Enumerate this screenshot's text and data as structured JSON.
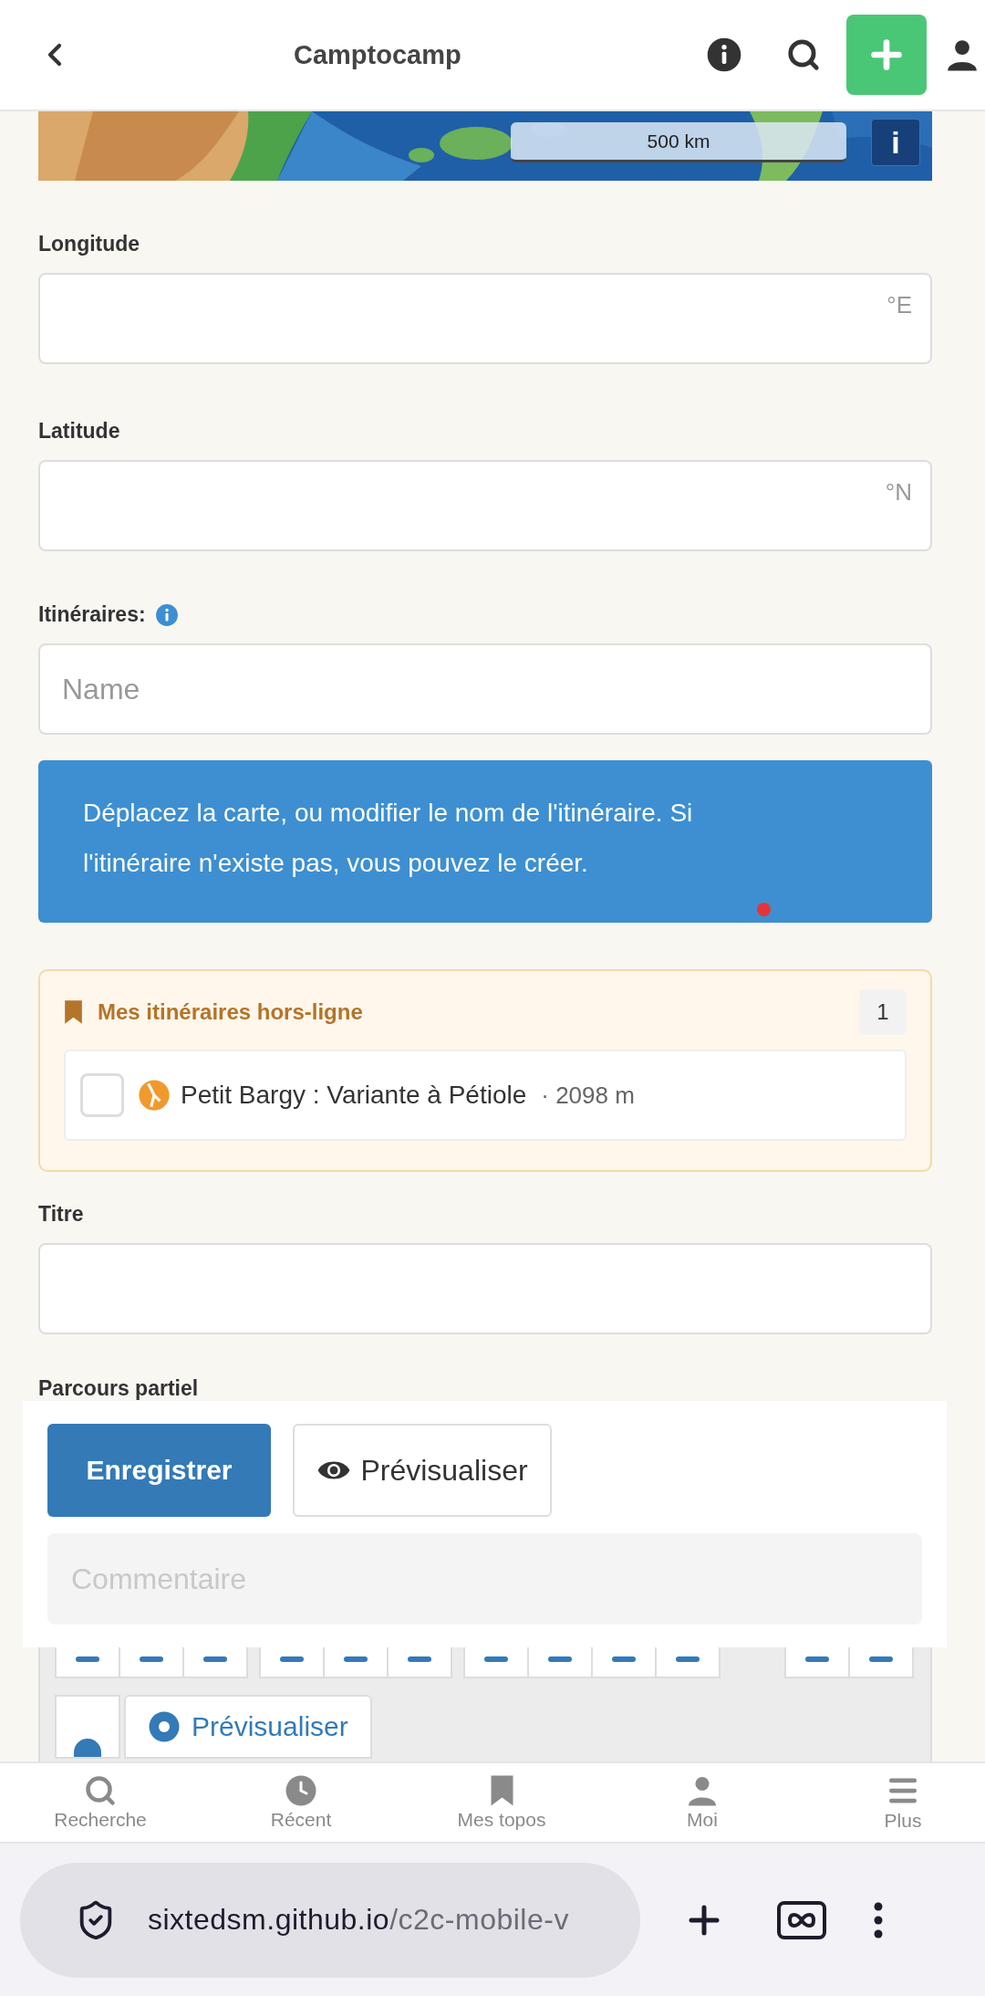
{
  "header": {
    "title": "Camptocamp"
  },
  "map": {
    "scale": "500 km",
    "info_button": "i"
  },
  "coordinates": [
    {
      "label": "Longitude",
      "unit": "°E"
    },
    {
      "label": "Latitude",
      "unit": "°N"
    }
  ],
  "itineraries": {
    "label": "Itinéraires:",
    "placeholder": "Name",
    "notice": "Déplacez la carte, ou modifier le nom de l'itinéraire. Si l'itinéraire n'existe pas, vous pouvez le créer."
  },
  "offline": {
    "title": "Mes itinéraires hors-ligne",
    "count": "1",
    "items": [
      {
        "name": "Petit Bargy : Variante à Pétiole",
        "elevation": "· 2098 m",
        "checked": false
      }
    ]
  },
  "title_field": {
    "label": "Titre"
  },
  "partial_route": {
    "label": "Parcours partiel"
  },
  "editor": {
    "preview": "Prévisualiser"
  },
  "save_panel": {
    "save": "Enregistrer",
    "preview": "Prévisualiser",
    "comment_placeholder": "Commentaire"
  },
  "bottom_nav": [
    {
      "label": "Recherche"
    },
    {
      "label": "Récent"
    },
    {
      "label": "Mes topos"
    },
    {
      "label": "Moi"
    },
    {
      "label": "Plus"
    }
  ],
  "browser": {
    "host": "sixtedsm.github.io",
    "path": "/c2c-mobile-v"
  }
}
